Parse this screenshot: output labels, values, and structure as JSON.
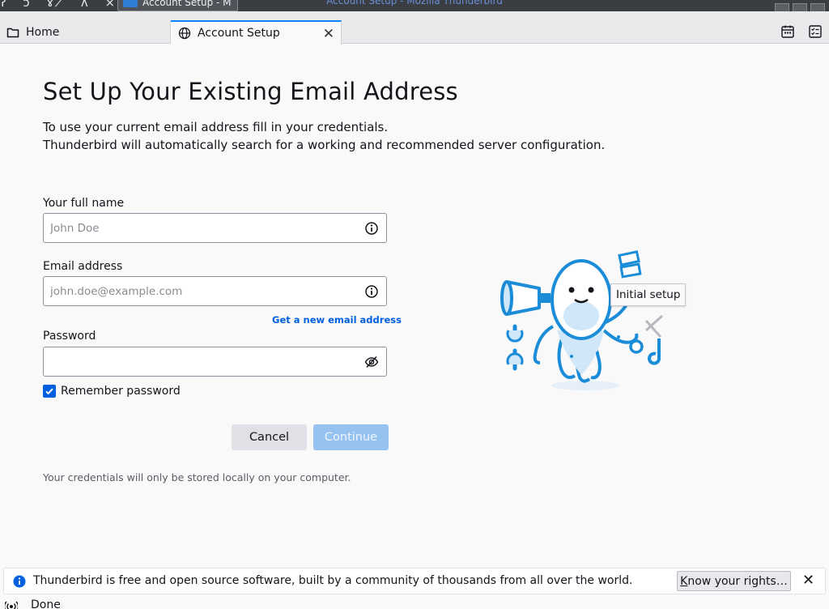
{
  "os": {
    "taskbar_glyphs": "ʔ ɔ ɤ ̸ ʌ × ↑",
    "task_label": "Account Setup - M",
    "window_title": "Account Setup - Mozilla Thunderbird"
  },
  "tabs": [
    {
      "label": "Home",
      "icon": "folder-icon",
      "active": false
    },
    {
      "label": "Account Setup",
      "icon": "globe-icon",
      "active": true
    }
  ],
  "toolbar_icons": [
    "calendar-icon",
    "tasks-icon"
  ],
  "page": {
    "title": "Set Up Your Existing Email Address",
    "intro_line1": "To use your current email address fill in your credentials.",
    "intro_line2": "Thunderbird will automatically search for a working and recommended server configuration."
  },
  "form": {
    "name": {
      "label": "Your full name",
      "placeholder": "John Doe",
      "value": ""
    },
    "email": {
      "label": "Email address",
      "placeholder": "john.doe@example.com",
      "value": ""
    },
    "get_new_email": "Get a new email address",
    "password": {
      "label": "Password",
      "value": ""
    },
    "remember": {
      "label": "Remember password",
      "checked": true
    },
    "cancel": "Cancel",
    "continue": "Continue",
    "privacy_note": "Your credentials will only be stored locally on your computer."
  },
  "illustration": {
    "tooltip": "Initial setup"
  },
  "notification": {
    "message": "Thunderbird is free and open source software, built by a community of thousands from all over the world.",
    "button_first": "K",
    "button_rest": "now your rights…"
  },
  "status": {
    "text": "Done"
  },
  "colors": {
    "accent": "#0060df",
    "tab_highlight": "#0a84ff",
    "continue_disabled": "#96c2ef",
    "octopus": "#1a8cd8"
  }
}
